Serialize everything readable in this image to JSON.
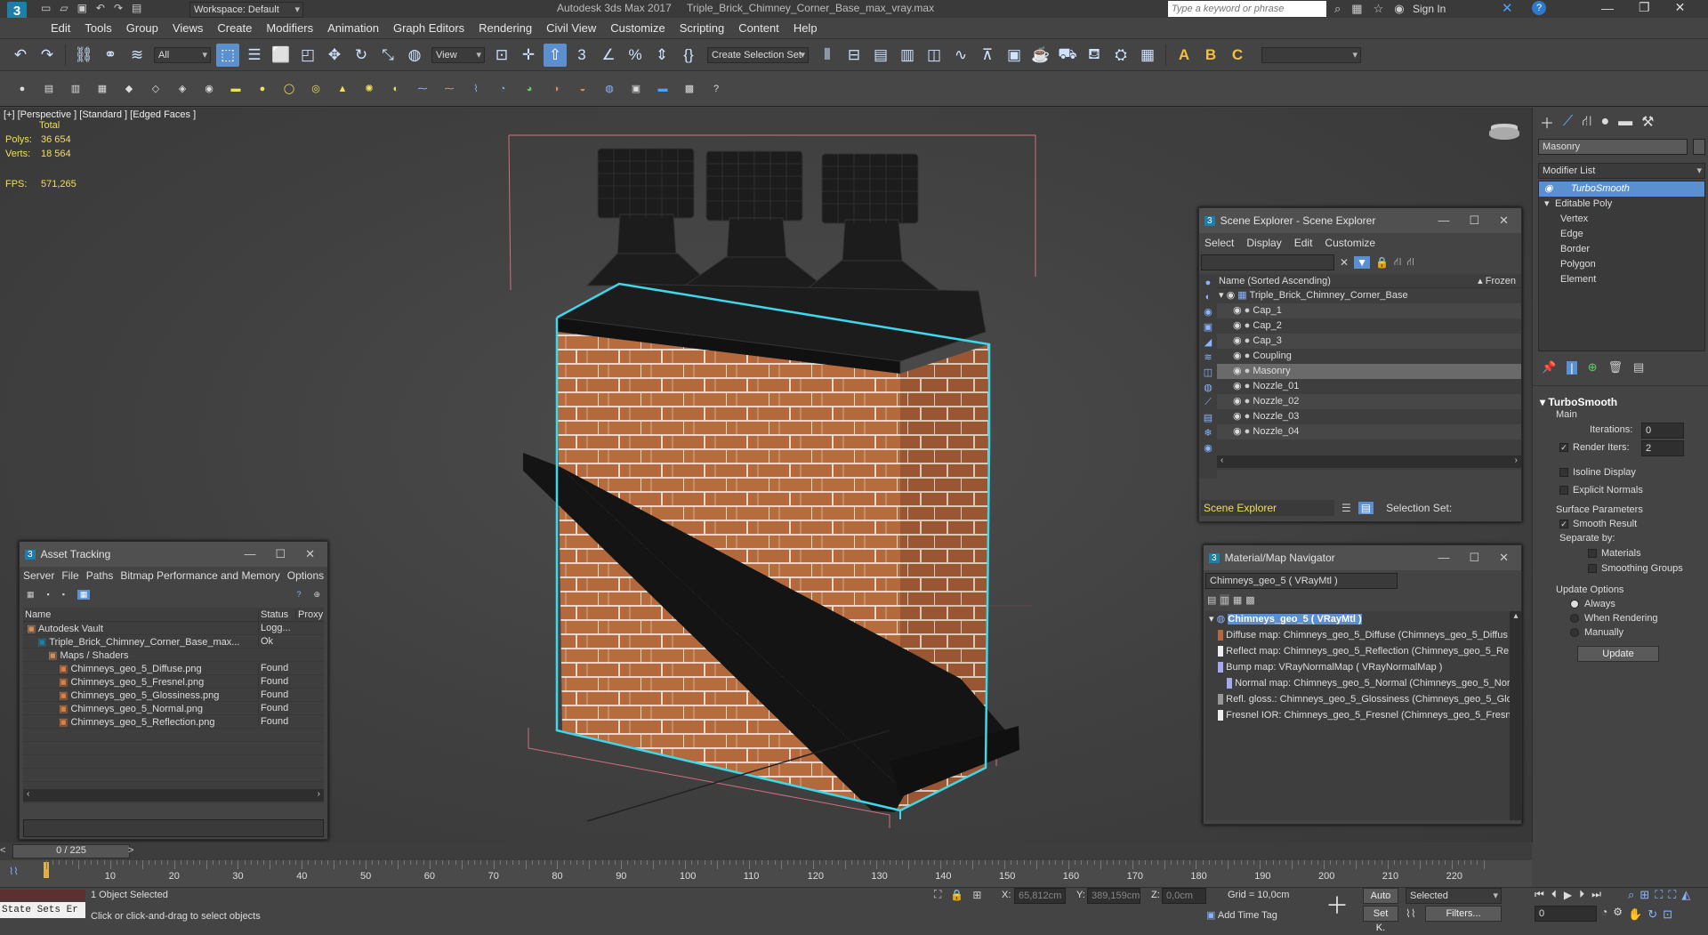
{
  "titlebar": {
    "workspace_label": "Workspace: Default",
    "app_title": "Autodesk 3ds Max 2017",
    "file_title": "Triple_Brick_Chimney_Corner_Base_max_vray.max",
    "search_placeholder": "Type a keyword or phrase",
    "sign_in": "Sign In"
  },
  "menu": [
    "Edit",
    "Tools",
    "Group",
    "Views",
    "Create",
    "Modifiers",
    "Animation",
    "Graph Editors",
    "Rendering",
    "Civil View",
    "Customize",
    "Scripting",
    "Content",
    "Help"
  ],
  "toolbar": {
    "filter_all": "All",
    "ref_coord": "View",
    "selection_set": "Create Selection Set"
  },
  "viewport": {
    "label": "[+] [Perspective ] [Standard ] [Edged Faces ]",
    "stats_header": "Total",
    "polys_label": "Polys:",
    "polys_value": "36 654",
    "verts_label": "Verts:",
    "verts_value": "18 564",
    "fps_label": "FPS:",
    "fps_value": "571,265"
  },
  "command_panel": {
    "object_name": "Masonry",
    "modifier_list": "Modifier List",
    "stack": [
      "TurboSmooth",
      "Editable Poly",
      "Vertex",
      "Edge",
      "Border",
      "Polygon",
      "Element"
    ],
    "rollout_title": "TurboSmooth",
    "main_label": "Main",
    "iterations_label": "Iterations:",
    "iterations_value": "0",
    "render_iters_label": "Render Iters:",
    "render_iters_value": "2",
    "isoline": "Isoline Display",
    "explicit_normals": "Explicit Normals",
    "surface_params": "Surface Parameters",
    "smooth_result": "Smooth Result",
    "separate_by": "Separate by:",
    "materials": "Materials",
    "smoothing_groups": "Smoothing Groups",
    "update_options": "Update Options",
    "always": "Always",
    "when_rendering": "When Rendering",
    "manually": "Manually",
    "update_button": "Update"
  },
  "scene_explorer": {
    "title": "Scene Explorer - Scene Explorer",
    "menu": [
      "Select",
      "Display",
      "Edit",
      "Customize"
    ],
    "col_name": "Name (Sorted Ascending)",
    "col_frozen": "▴ Frozen",
    "root": "Triple_Brick_Chimney_Corner_Base",
    "items": [
      "Cap_1",
      "Cap_2",
      "Cap_3",
      "Coupling",
      "Masonry",
      "Nozzle_01",
      "Nozzle_02",
      "Nozzle_03",
      "Nozzle_04"
    ],
    "footer_label": "Scene Explorer",
    "selection_set": "Selection Set:"
  },
  "material_nav": {
    "title": "Material/Map Navigator",
    "current": "Chimneys_geo_5  ( VRayMtl )",
    "root": "Chimneys_geo_5  ( VRayMtl )",
    "maps": [
      "Diffuse map: Chimneys_geo_5_Diffuse (Chimneys_geo_5_Diffus",
      "Reflect map: Chimneys_geo_5_Reflection (Chimneys_geo_5_Re",
      "Bump map: VRayNormalMap  ( VRayNormalMap )",
      "Normal map: Chimneys_geo_5_Normal (Chimneys_geo_5_Nor",
      "Refl. gloss.: Chimneys_geo_5_Glossiness (Chimneys_geo_5_Glos",
      "Fresnel IOR: Chimneys_geo_5_Fresnel (Chimneys_geo_5_Fresn"
    ]
  },
  "asset_tracking": {
    "title": "Asset Tracking",
    "menu": [
      "Server",
      "File",
      "Paths",
      "Bitmap Performance and Memory",
      "Options"
    ],
    "col_name": "Name",
    "col_status": "Status",
    "col_proxy": "Proxy",
    "rows": [
      {
        "name": "Autodesk Vault",
        "status": "Logg...",
        "indent": 0
      },
      {
        "name": "Triple_Brick_Chimney_Corner_Base_max...",
        "status": "Ok",
        "indent": 1
      },
      {
        "name": "Maps / Shaders",
        "status": "",
        "indent": 2
      },
      {
        "name": "Chimneys_geo_5_Diffuse.png",
        "status": "Found",
        "indent": 3
      },
      {
        "name": "Chimneys_geo_5_Fresnel.png",
        "status": "Found",
        "indent": 3
      },
      {
        "name": "Chimneys_geo_5_Glossiness.png",
        "status": "Found",
        "indent": 3
      },
      {
        "name": "Chimneys_geo_5_Normal.png",
        "status": "Found",
        "indent": 3
      },
      {
        "name": "Chimneys_geo_5_Reflection.png",
        "status": "Found",
        "indent": 3
      }
    ]
  },
  "timeline": {
    "frame": "0 / 225",
    "ticks": [
      "10",
      "20",
      "30",
      "40",
      "50",
      "60",
      "70",
      "80",
      "90",
      "100",
      "110",
      "120",
      "130",
      "140",
      "150",
      "160",
      "170",
      "180",
      "190",
      "200",
      "210",
      "220"
    ]
  },
  "status": {
    "state_sets": "State Sets Er",
    "selected": "1 Object Selected",
    "hint": "Click or click-and-drag to select objects",
    "x_label": "X:",
    "x_value": "65,812cm",
    "y_label": "Y:",
    "y_value": "389,159cm",
    "z_label": "Z:",
    "z_value": "0,0cm",
    "grid": "Grid = 10,0cm",
    "add_time_tag": "Add Time Tag",
    "auto": "Auto",
    "set_k": "Set K.",
    "selected_dd": "Selected",
    "filters": "Filters...",
    "frame_input": "0"
  },
  "colors": {
    "selection_blue": "#3fd7ea",
    "brick": "#b5683c",
    "highlight": "#5a8fd0"
  }
}
